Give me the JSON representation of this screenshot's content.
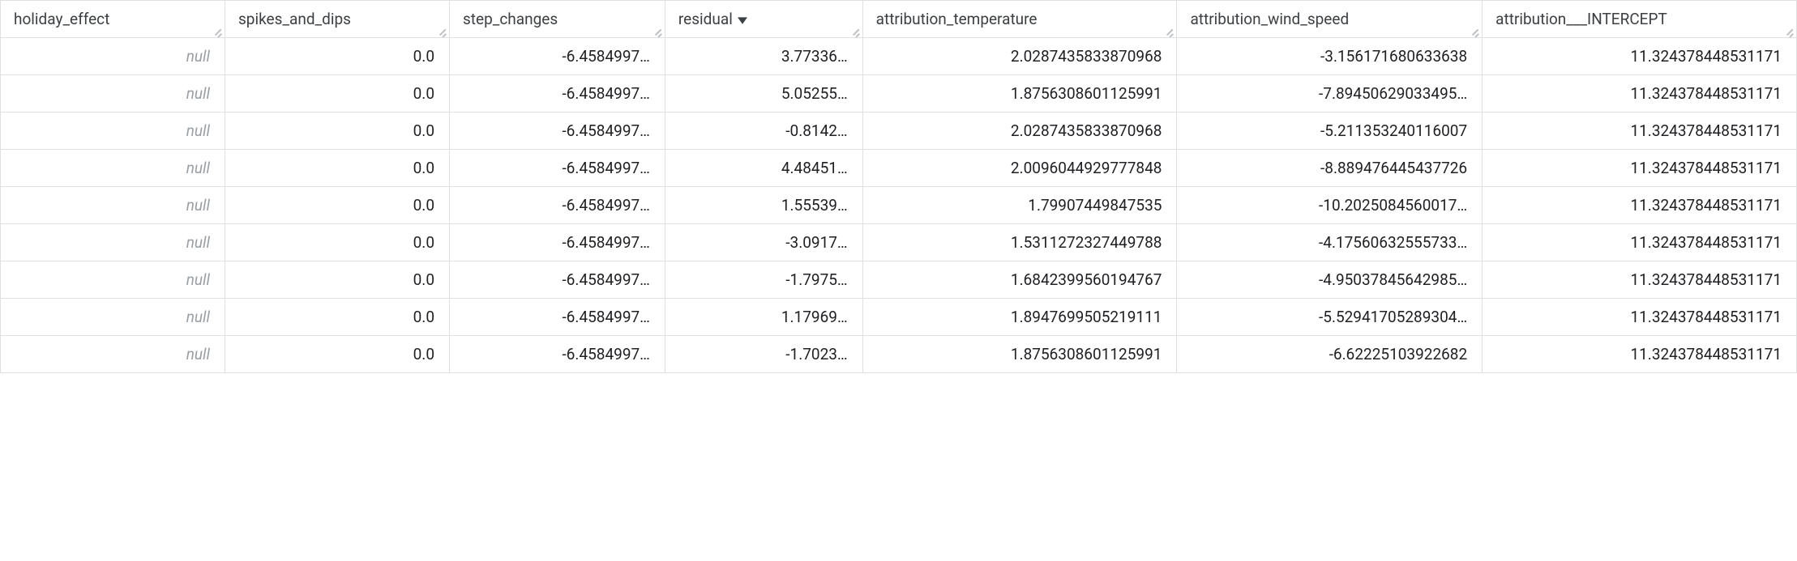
{
  "table": {
    "sorted_column_index": 3,
    "sort_direction": "desc",
    "columns": [
      {
        "label": "holiday_effect"
      },
      {
        "label": "spikes_and_dips"
      },
      {
        "label": "step_changes"
      },
      {
        "label": "residual"
      },
      {
        "label": "attribution_temperature"
      },
      {
        "label": "attribution_wind_speed"
      },
      {
        "label": "attribution___INTERCEPT"
      }
    ],
    "null_label": "null",
    "rows": [
      {
        "holiday_effect": null,
        "spikes_and_dips": "0.0",
        "step_changes": "-6.4584997…",
        "residual": "3.77336…",
        "attribution_temperature": "2.0287435833870968",
        "attribution_wind_speed": "-3.156171680633638",
        "attribution___INTERCEPT": "11.324378448531171"
      },
      {
        "holiday_effect": null,
        "spikes_and_dips": "0.0",
        "step_changes": "-6.4584997…",
        "residual": "5.05255…",
        "attribution_temperature": "1.8756308601125991",
        "attribution_wind_speed": "-7.89450629033495…",
        "attribution___INTERCEPT": "11.324378448531171"
      },
      {
        "holiday_effect": null,
        "spikes_and_dips": "0.0",
        "step_changes": "-6.4584997…",
        "residual": "-0.8142…",
        "attribution_temperature": "2.0287435833870968",
        "attribution_wind_speed": "-5.211353240116007",
        "attribution___INTERCEPT": "11.324378448531171"
      },
      {
        "holiday_effect": null,
        "spikes_and_dips": "0.0",
        "step_changes": "-6.4584997…",
        "residual": "4.48451…",
        "attribution_temperature": "2.0096044929777848",
        "attribution_wind_speed": "-8.889476445437726",
        "attribution___INTERCEPT": "11.324378448531171"
      },
      {
        "holiday_effect": null,
        "spikes_and_dips": "0.0",
        "step_changes": "-6.4584997…",
        "residual": "1.55539…",
        "attribution_temperature": "1.79907449847535",
        "attribution_wind_speed": "-10.2025084560017…",
        "attribution___INTERCEPT": "11.324378448531171"
      },
      {
        "holiday_effect": null,
        "spikes_and_dips": "0.0",
        "step_changes": "-6.4584997…",
        "residual": "-3.0917…",
        "attribution_temperature": "1.5311272327449788",
        "attribution_wind_speed": "-4.17560632555733…",
        "attribution___INTERCEPT": "11.324378448531171"
      },
      {
        "holiday_effect": null,
        "spikes_and_dips": "0.0",
        "step_changes": "-6.4584997…",
        "residual": "-1.7975…",
        "attribution_temperature": "1.6842399560194767",
        "attribution_wind_speed": "-4.95037845642985…",
        "attribution___INTERCEPT": "11.324378448531171"
      },
      {
        "holiday_effect": null,
        "spikes_and_dips": "0.0",
        "step_changes": "-6.4584997…",
        "residual": "1.17969…",
        "attribution_temperature": "1.8947699505219111",
        "attribution_wind_speed": "-5.52941705289304…",
        "attribution___INTERCEPT": "11.324378448531171"
      },
      {
        "holiday_effect": null,
        "spikes_and_dips": "0.0",
        "step_changes": "-6.4584997…",
        "residual": "-1.7023…",
        "attribution_temperature": "1.8756308601125991",
        "attribution_wind_speed": "-6.62225103922682",
        "attribution___INTERCEPT": "11.324378448531171"
      }
    ]
  }
}
